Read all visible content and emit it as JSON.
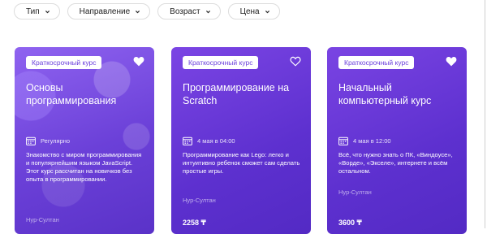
{
  "filters": [
    {
      "label": "Тип"
    },
    {
      "label": "Направление"
    },
    {
      "label": "Возраст"
    },
    {
      "label": "Цена"
    }
  ],
  "cards": [
    {
      "badge": "Краткосрочный курс",
      "title": "Основы программирования",
      "date": "Регулярно",
      "description": "Знакомство с миром программирования и популярнейшим языком JavaScript. Этот курс рассчитан на новичков без опыта в программировании.",
      "location": "Нур-Султан",
      "price": "",
      "favorited": true
    },
    {
      "badge": "Краткосрочный курс",
      "title": "Программирование на Scratch",
      "date": "4 мая в 04:00",
      "description": "Программирование как Lego: легко и интуитивно ребенок сможет сам сделать простые игры.",
      "location": "Нур-Султан",
      "price": "2258 ₸",
      "favorited": false
    },
    {
      "badge": "Краткосрочный курс",
      "title": "Начальный компьютерный курс",
      "date": "4 мая в 12:00",
      "description": "Всё, что нужно знать о ПК, «Виндоусе», «Ворде», «Экселе», интернете и всём остальном.",
      "location": "Нур-Султан",
      "price": "3600 ₸",
      "favorited": true
    }
  ],
  "colors": {
    "accent": "#6b3fdc",
    "card_bg": "#5d30cf"
  }
}
